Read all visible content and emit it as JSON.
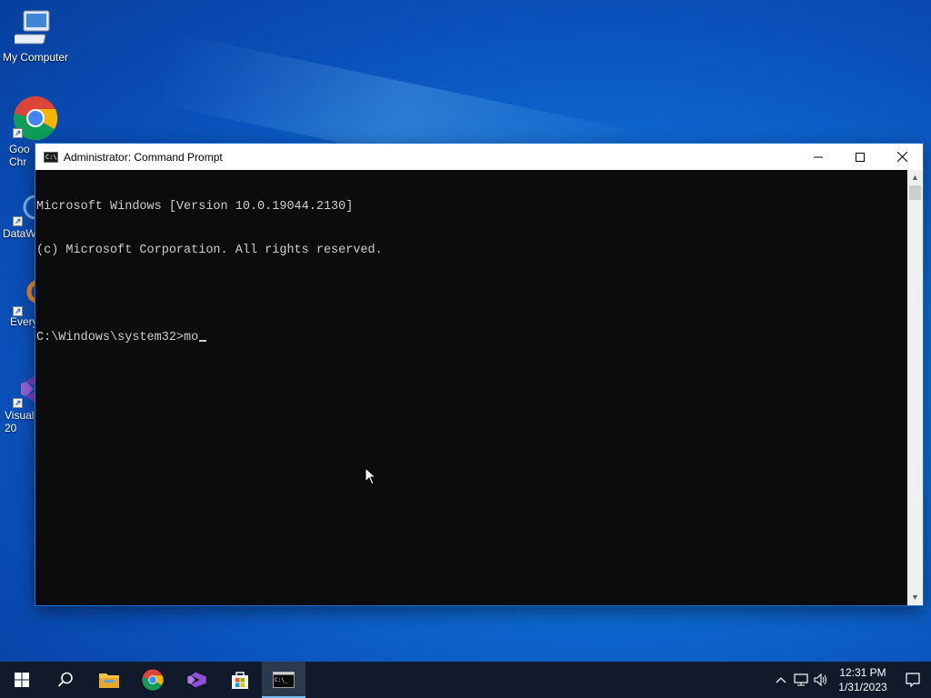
{
  "desktop": {
    "icons": [
      {
        "name": "my-computer",
        "label": "My Computer"
      },
      {
        "name": "google-chrome",
        "label": "Goo\nChr"
      },
      {
        "name": "datawrapper",
        "label": "DataW"
      },
      {
        "name": "everything",
        "label": "Every"
      },
      {
        "name": "visual-studio",
        "label": "Visual\n20"
      }
    ]
  },
  "window": {
    "title": "Administrator: Command Prompt",
    "title_icon_text": "C:\\",
    "minimize_glyph": "—",
    "maximize_glyph": "☐",
    "close_glyph": "✕",
    "console_lines": [
      "Microsoft Windows [Version 10.0.19044.2130]",
      "(c) Microsoft Corporation. All rights reserved.",
      "",
      "C:\\Windows\\system32>mo"
    ],
    "scroll_up_glyph": "▲",
    "scroll_down_glyph": "▼"
  },
  "taskbar": {
    "items": [
      {
        "name": "start-button",
        "icon": "windows-logo-icon"
      },
      {
        "name": "search-button",
        "icon": "search-icon"
      },
      {
        "name": "file-explorer",
        "icon": "folder-icon"
      },
      {
        "name": "chrome",
        "icon": "chrome-icon"
      },
      {
        "name": "visual-studio",
        "icon": "visual-studio-icon"
      },
      {
        "name": "microsoft-store",
        "icon": "store-icon"
      },
      {
        "name": "command-prompt",
        "icon": "cmd-icon",
        "active": true
      }
    ],
    "tray": {
      "chevron": "^",
      "time": "12:31 PM",
      "date": "1/31/2023"
    }
  },
  "colors": {
    "console_bg": "#0c0c0c",
    "console_fg": "#cccccc",
    "taskbar_bg": "#101a2a",
    "active_indicator": "#76b9ed"
  }
}
